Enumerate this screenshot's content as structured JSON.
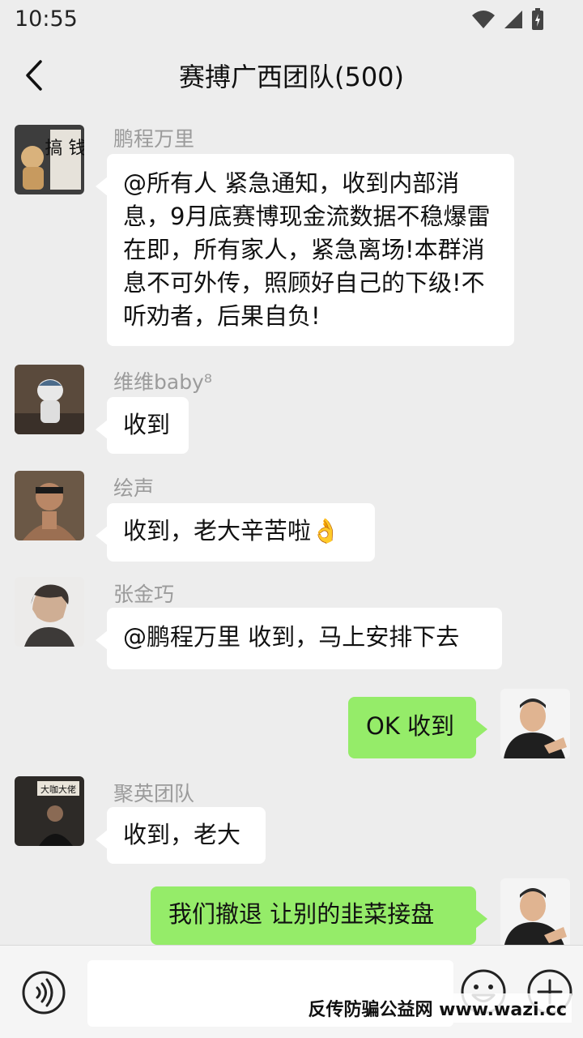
{
  "status_bar": {
    "time": "10:55"
  },
  "header": {
    "title": "赛搏广西团队(500)"
  },
  "messages": [
    {
      "sender": "鹏程万里",
      "text": "@所有人 紧急通知，收到内部消息，9月底赛博现金流数据不稳爆雷在即，所有家人，紧急离场!本群消息不可外传，照顾好自己的下级!不听劝者，后果自负!"
    },
    {
      "sender": "维维baby⁸",
      "text": "收到"
    },
    {
      "sender": "绘声",
      "text": "收到，老大辛苦啦👌"
    },
    {
      "sender": "张金巧",
      "text": "@鹏程万里 收到，马上安排下去"
    },
    {
      "sender": "",
      "text": "OK 收到"
    },
    {
      "sender": "聚英团队",
      "text": "收到，老大"
    },
    {
      "sender": "",
      "text": "我们撤退 让别的韭菜接盘"
    }
  ],
  "avatar_text": {
    "first": "搞 钱",
    "sign": "大咖大佬"
  },
  "watermark": "反传防骗公益网 www.wazi.cc",
  "colors": {
    "background": "#ededed",
    "bubble_other": "#ffffff",
    "bubble_mine": "#95ec69",
    "sender": "#9b9b9b"
  }
}
